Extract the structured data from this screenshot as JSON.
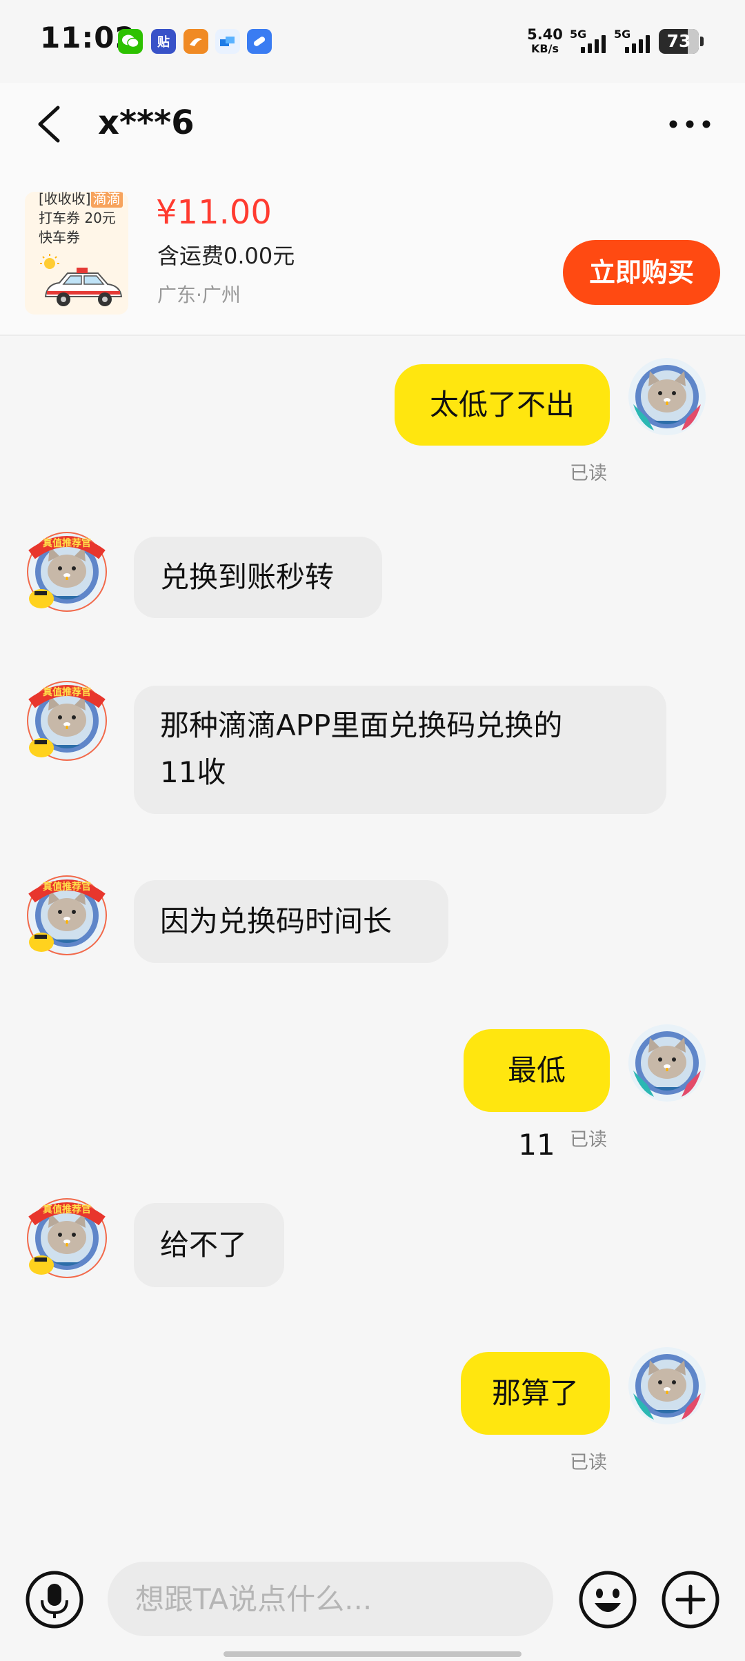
{
  "status_bar": {
    "time": "11:02",
    "net_speed_value": "5.40",
    "net_speed_unit": "KB/s",
    "sim1_label": "5G",
    "sim2_label": "5G",
    "battery": "73",
    "battery_level": 0.73,
    "app_icons": [
      "wechat-icon",
      "tieba-icon",
      "guangdong-app-icon",
      "file-transfer-icon",
      "pill-app-icon"
    ]
  },
  "header": {
    "title": "x***6"
  },
  "product": {
    "thumb_line1": "[收收收]",
    "thumb_tag": "滴滴",
    "thumb_line2": "打车券 20元",
    "thumb_line3": "快车券",
    "price": "¥11.00",
    "shipping": "含运费0.00元",
    "location": "广东·广州",
    "buy_label": "立即购买"
  },
  "messages": [
    {
      "side": "mine",
      "text": "太低了不出",
      "read": "已读"
    },
    {
      "side": "theirs",
      "text": "兑换到账秒转"
    },
    {
      "side": "theirs",
      "text_line1": "那种滴滴APP里面兑换码兑换的",
      "text_line2": "11收"
    },
    {
      "side": "theirs",
      "text": "因为兑换码时间长"
    },
    {
      "side": "mine",
      "text": "最低11",
      "read": "已读"
    },
    {
      "side": "theirs",
      "text": "给不了"
    },
    {
      "side": "mine",
      "text": "那算了",
      "read": "已读"
    }
  ],
  "avatar_badge": "真值推荐官",
  "input": {
    "placeholder": "想跟TA说点什么..."
  },
  "colors": {
    "my_bubble": "#ffe60f",
    "their_bubble": "#ececec",
    "price": "#ff3b30",
    "buy_button": "#ff4a12"
  }
}
